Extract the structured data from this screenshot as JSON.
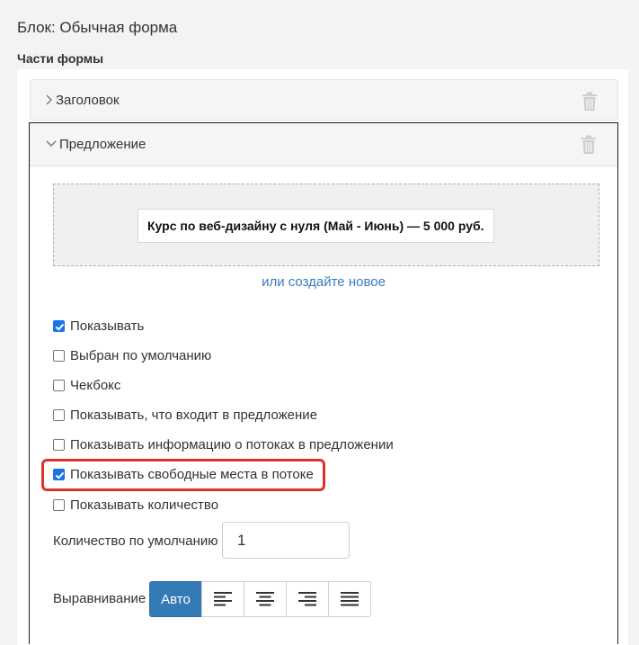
{
  "block": {
    "title": "Блок: Обычная форма"
  },
  "section": {
    "label": "Части формы"
  },
  "parts": [
    {
      "label": "Заголовок",
      "expanded": false
    },
    {
      "label": "Предложение",
      "expanded": true
    }
  ],
  "offer": {
    "selected_label": "Курс по веб-дизайну с нуля (Май - Июнь) — 5 000 руб.",
    "create_link": "или создайте новое"
  },
  "options": [
    {
      "label": "Показывать",
      "checked": true
    },
    {
      "label": "Выбран по умолчанию",
      "checked": false
    },
    {
      "label": "Чекбокс",
      "checked": false
    },
    {
      "label": "Показывать, что входит в предложение",
      "checked": false
    },
    {
      "label": "Показывать информацию о потоках в предложении",
      "checked": false
    },
    {
      "label": "Показывать свободные места в потоке",
      "checked": true,
      "highlighted": true
    },
    {
      "label": "Показывать количество",
      "checked": false
    }
  ],
  "quantity": {
    "label": "Количество по умолчанию",
    "value": "1"
  },
  "alignment": {
    "label": "Выравнивание",
    "auto_label": "Авто",
    "options": [
      "auto",
      "left",
      "center",
      "right",
      "justify"
    ],
    "selected": "auto"
  },
  "colors": {
    "accent": "#337ab7",
    "link": "#3a7bbf",
    "highlight": "#d9342b",
    "checkbox": "#1a73e8"
  }
}
